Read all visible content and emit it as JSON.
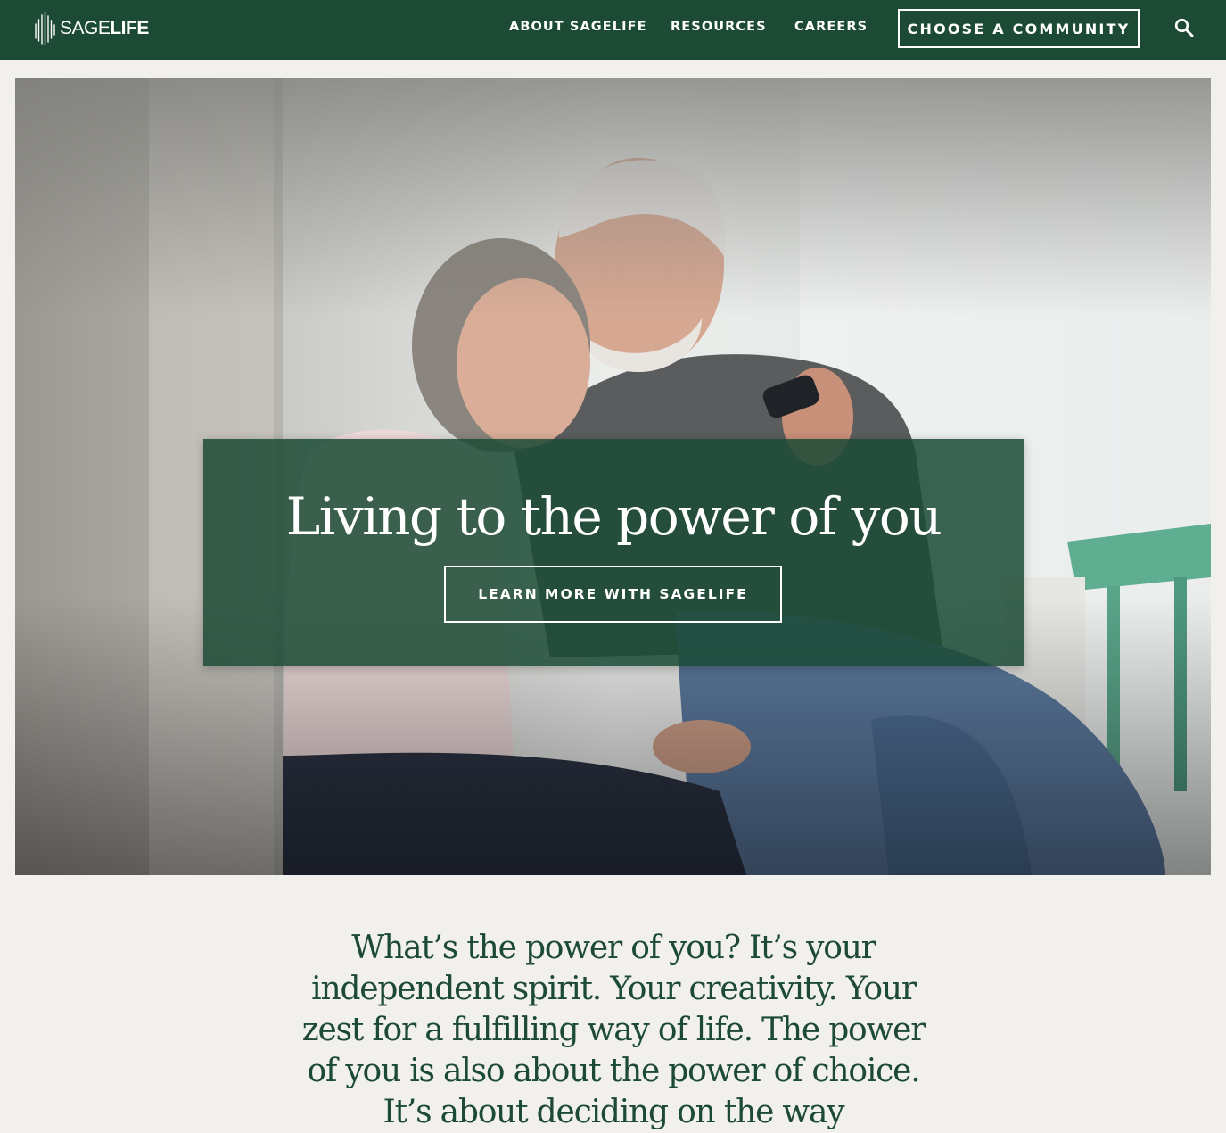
{
  "brand": {
    "name_light": "SAGE",
    "name_bold": "LIFE",
    "primary_color": "#1c4a35",
    "background_color": "#f1f0ed"
  },
  "nav": {
    "items": [
      {
        "label": "ABOUT SAGELIFE"
      },
      {
        "label": "RESOURCES"
      },
      {
        "label": "CAREERS"
      }
    ],
    "cta_label": "CHOOSE A COMMUNITY",
    "search_icon": "search-icon"
  },
  "hero": {
    "title": "Living to the power of you",
    "button_label": "LEARN MORE WITH SAGELIFE",
    "image_alt": "Senior couple smiling while looking at a smartphone"
  },
  "intro": {
    "text": "What’s the power of you? It’s your independent spirit. Your creativity. Your zest for a fulfilling way of life. The power of you is also about the power of choice. It’s about deciding on the way"
  }
}
